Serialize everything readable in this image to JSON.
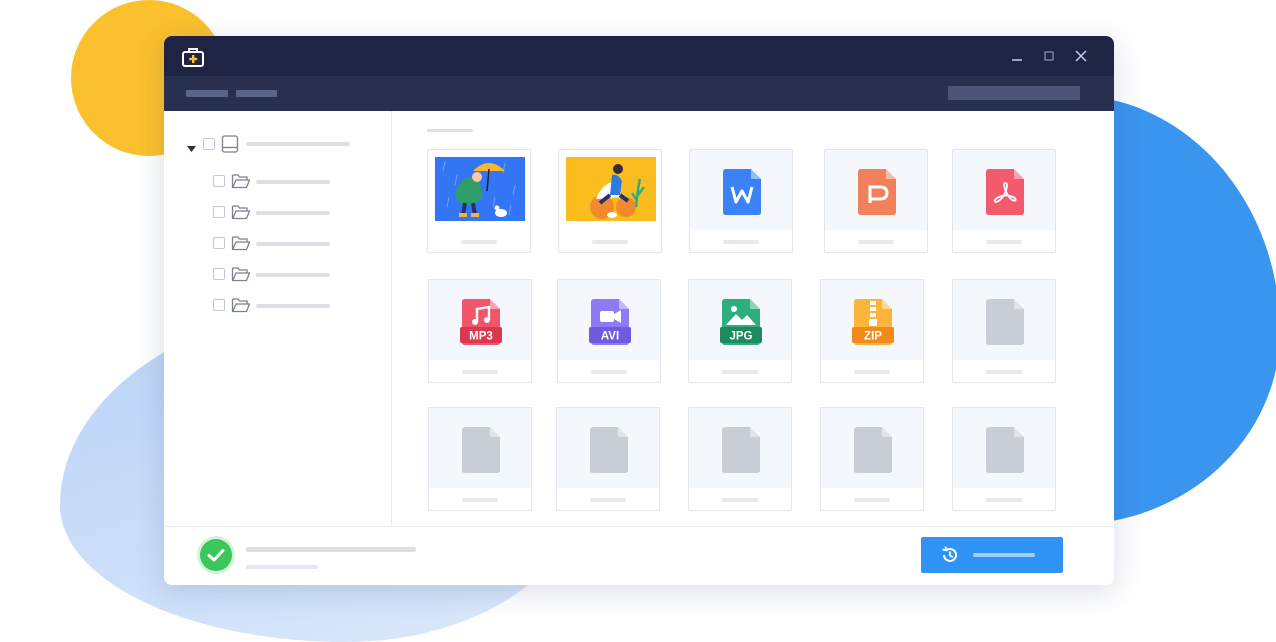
{
  "colors": {
    "titlebar": "#1f2444",
    "menubar": "#292f4f",
    "accent": "#2f92f5",
    "success": "#3cc65b",
    "yellow_blob": "#fbc02d",
    "blue_blob": "#3a95ef"
  },
  "window": {
    "icon": "recovery-toolbox-icon",
    "controls": [
      "minimize-icon",
      "maximize-icon",
      "close-icon"
    ]
  },
  "sidebar": {
    "root": {
      "icon": "drive-icon",
      "expanded": true
    },
    "folders": [
      {
        "icon": "folder-icon"
      },
      {
        "icon": "folder-icon"
      },
      {
        "icon": "folder-icon"
      },
      {
        "icon": "folder-icon"
      },
      {
        "icon": "folder-icon"
      }
    ]
  },
  "files": [
    {
      "type": "image",
      "icon": "photo-rain-umbrella-thumbnail"
    },
    {
      "type": "image",
      "icon": "photo-reading-woman-thumbnail"
    },
    {
      "type": "word",
      "icon": "word-document-icon",
      "letter": "W",
      "color": "#3b82f6"
    },
    {
      "type": "ppt",
      "icon": "powerpoint-document-icon",
      "letter": "P",
      "color": "#f2805a"
    },
    {
      "type": "pdf",
      "icon": "pdf-document-icon",
      "letter": "",
      "color": "#f25a6e"
    },
    {
      "type": "mp3",
      "icon": "mp3-file-icon",
      "label": "MP3",
      "color": "#f0566b",
      "band": "#d9384f"
    },
    {
      "type": "avi",
      "icon": "avi-file-icon",
      "label": "AVI",
      "color": "#8b7cf6",
      "band": "#6d5ce0"
    },
    {
      "type": "jpg",
      "icon": "jpg-file-icon",
      "label": "JPG",
      "color": "#2fae7d",
      "band": "#1d8a5f"
    },
    {
      "type": "zip",
      "icon": "zip-file-icon",
      "label": "ZIP",
      "color": "#fdb43a",
      "band": "#f28a1c"
    },
    {
      "type": "generic",
      "icon": "generic-file-icon"
    },
    {
      "type": "generic",
      "icon": "generic-file-icon"
    },
    {
      "type": "generic",
      "icon": "generic-file-icon"
    },
    {
      "type": "generic",
      "icon": "generic-file-icon"
    },
    {
      "type": "generic",
      "icon": "generic-file-icon"
    },
    {
      "type": "generic",
      "icon": "generic-file-icon"
    }
  ],
  "footer": {
    "status_icon": "checkmark-icon",
    "recover_button_icon": "history-icon"
  }
}
